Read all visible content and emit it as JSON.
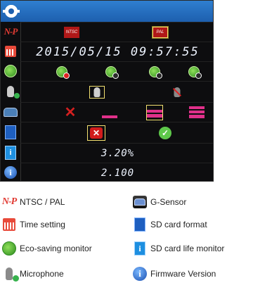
{
  "screen": {
    "ntsc_pal": {
      "icon": "np-logo-icon",
      "options": [
        "NTSC",
        "PAL"
      ],
      "selected": "PAL"
    },
    "time": {
      "icon": "calendar-icon",
      "value": "2015/05/15  09:57:55"
    },
    "eco": {
      "icon": "leaf-icon",
      "option_icons": [
        "eco-off-icon",
        "eco-level-1-icon",
        "eco-level-2-icon",
        "eco-level-3-icon"
      ]
    },
    "microphone": {
      "icon": "microphone-icon",
      "options": [
        "microphone-on-icon",
        "microphone-off-icon"
      ],
      "selected": "microphone-on-icon"
    },
    "gsensor": {
      "icon": "car-icon",
      "options": [
        "off",
        "low",
        "medium",
        "high"
      ],
      "selected": "medium"
    },
    "sd_format": {
      "icon": "sd-card-icon",
      "options": [
        "cancel-icon",
        "confirm-icon"
      ],
      "selected": "cancel-icon"
    },
    "sd_life": {
      "icon": "sd-life-icon",
      "value": "3.20%"
    },
    "firmware": {
      "icon": "info-icon",
      "value": "2.100"
    }
  },
  "legend": [
    {
      "icon": "np-logo-icon",
      "icon_text": "N-P",
      "label": "NTSC / PAL"
    },
    {
      "icon": "g-sensor-icon",
      "label": "G-Sensor"
    },
    {
      "icon": "calendar-icon",
      "label": "Time setting"
    },
    {
      "icon": "sd-card-icon",
      "label": "SD card format"
    },
    {
      "icon": "leaf-icon",
      "label": "Eco-saving monitor"
    },
    {
      "icon": "sd-life-icon",
      "label": "SD card life monitor"
    },
    {
      "icon": "microphone-icon",
      "label": "Microphone"
    },
    {
      "icon": "info-icon",
      "label": "Firmware Version"
    }
  ],
  "colors": {
    "topbar": "#2f7fd0",
    "screen_bg": "#0d0d0f",
    "selection": "#f2e070",
    "ntsc_pal_chip": "#b01818",
    "gsensor_bar": "#e0308a",
    "confirm": "#5ec84a",
    "cancel": "#d21b1b"
  }
}
